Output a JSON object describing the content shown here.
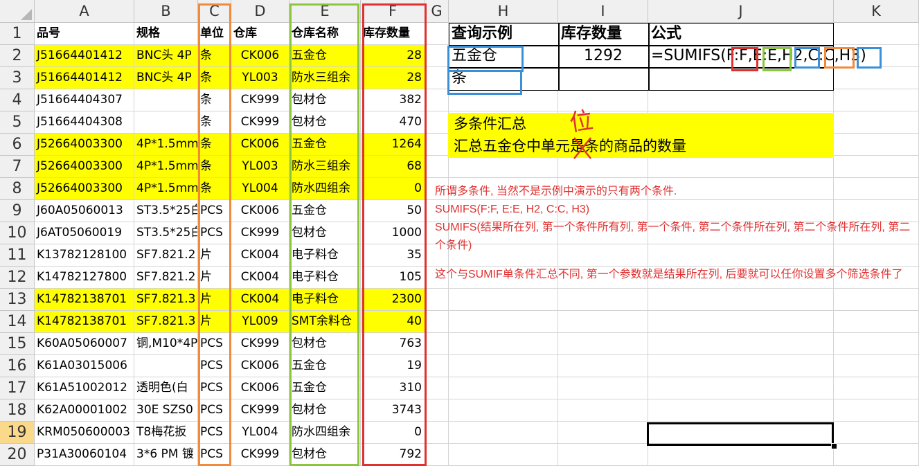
{
  "columns": [
    "A",
    "B",
    "C",
    "D",
    "E",
    "F",
    "G",
    "H",
    "I",
    "J",
    "K"
  ],
  "rows": [
    "1",
    "2",
    "3",
    "4",
    "5",
    "6",
    "7",
    "8",
    "9",
    "10",
    "11",
    "12",
    "13",
    "14",
    "15",
    "16",
    "17",
    "18",
    "19",
    "20"
  ],
  "selected_row": "19",
  "headers": {
    "A": "品号",
    "B": "规格",
    "C": "单位",
    "D": "仓库",
    "E": "仓库名称",
    "F": "库存数量"
  },
  "data_rows": [
    {
      "A": "J51664401412",
      "B": "BNC头 4P",
      "C": "条",
      "D": "CK006",
      "E": "五金仓",
      "F": "28",
      "hl": true
    },
    {
      "A": "J51664401412",
      "B": "BNC头 4P",
      "C": "条",
      "D": "YL003",
      "E": "防水三组余",
      "F": "28",
      "hl": true
    },
    {
      "A": "J51664404307",
      "B": "",
      "C": "条",
      "D": "CK999",
      "E": "包材仓",
      "F": "382",
      "hl": false
    },
    {
      "A": "J51664404308",
      "B": "",
      "C": "条",
      "D": "CK999",
      "E": "包材仓",
      "F": "470",
      "hl": false
    },
    {
      "A": "J52664003300",
      "B": "4P*1.5mm",
      "C": "条",
      "D": "CK006",
      "E": "五金仓",
      "F": "1264",
      "hl": true
    },
    {
      "A": "J52664003300",
      "B": "4P*1.5mm",
      "C": "条",
      "D": "YL003",
      "E": "防水三组余",
      "F": "68",
      "hl": true
    },
    {
      "A": "J52664003300",
      "B": "4P*1.5mm",
      "C": "条",
      "D": "YL004",
      "E": "防水四组余",
      "F": "0",
      "hl": true
    },
    {
      "A": "J60A05060013",
      "B": "ST3.5*25白",
      "C": "PCS",
      "D": "CK006",
      "E": "五金仓",
      "F": "50",
      "hl": false
    },
    {
      "A": "J6AT05060019",
      "B": "ST3.5*25白",
      "C": "PCS",
      "D": "CK999",
      "E": "包材仓",
      "F": "1000",
      "hl": false
    },
    {
      "A": "K13782128100",
      "B": "SF7.821.2",
      "C": "片",
      "D": "CK004",
      "E": "电子料仓",
      "F": "35",
      "hl": false
    },
    {
      "A": "K14782127800",
      "B": "SF7.821.2",
      "C": "片",
      "D": "CK004",
      "E": "电子料仓",
      "F": "105",
      "hl": false
    },
    {
      "A": "K14782138701",
      "B": "SF7.821.3",
      "C": "片",
      "D": "CK004",
      "E": "电子料仓",
      "F": "2300",
      "hl": true
    },
    {
      "A": "K14782138701",
      "B": "SF7.821.3",
      "C": "片",
      "D": "YL009",
      "E": "SMT余料仓",
      "F": "40",
      "hl": true
    },
    {
      "A": "K60A05060007",
      "B": "铜,M10*4P",
      "C": "PCS",
      "D": "CK999",
      "E": "包材仓",
      "F": "763",
      "hl": false
    },
    {
      "A": "K61A03015006",
      "B": "",
      "C": "PCS",
      "D": "CK006",
      "E": "五金仓",
      "F": "19",
      "hl": false
    },
    {
      "A": "K61A51002012",
      "B": "透明色(白",
      "C": "PCS",
      "D": "CK006",
      "E": "五金仓",
      "F": "310",
      "hl": false
    },
    {
      "A": "K62A00001002",
      "B": "30E SZS0",
      "C": "PCS",
      "D": "CK999",
      "E": "包材仓",
      "F": "3743",
      "hl": false
    },
    {
      "A": "KRM050600003",
      "B": "T8梅花扳",
      "C": "PCS",
      "D": "YL004",
      "E": "防水四组余",
      "F": "0",
      "hl": false
    },
    {
      "A": "P31A30060104",
      "B": "3*6 PM 镀",
      "C": "PCS",
      "D": "CK999",
      "E": "包材仓",
      "F": "792",
      "hl": false
    }
  ],
  "query": {
    "h_header": "查询示例",
    "i_header": "库存数量",
    "j_header": "公式",
    "h2": "五金仓",
    "i2": "1292",
    "j2": "=SUMIFS(F:F,E:E,H2,C:C,H3)",
    "h3": "条"
  },
  "yellow_note": {
    "line1": "多条件汇总",
    "line2": "汇总五金仓中单元是条的商品的数量",
    "handwritten": "位"
  },
  "explanation": [
    "所谓多条件, 当然不是示例中演示的只有两个条件.",
    "SUMIFS(F:F, E:E, H2, C:C, H3)",
    "SUMIFS(结果所在列, 第一个条件所有列, 第一个条件, 第二个条件所在列, 第二个条件所在列, 第二个条件)",
    "这个与SUMIF单条件汇总不同, 第一个参数就是结果所在列, 后要就可以任你设置多个筛选条件了"
  ],
  "colors": {
    "highlight": "#ffff00",
    "red": "#e03030",
    "orange": "#f08a3c",
    "green": "#8cc63f",
    "blue": "#3a8fd8"
  }
}
